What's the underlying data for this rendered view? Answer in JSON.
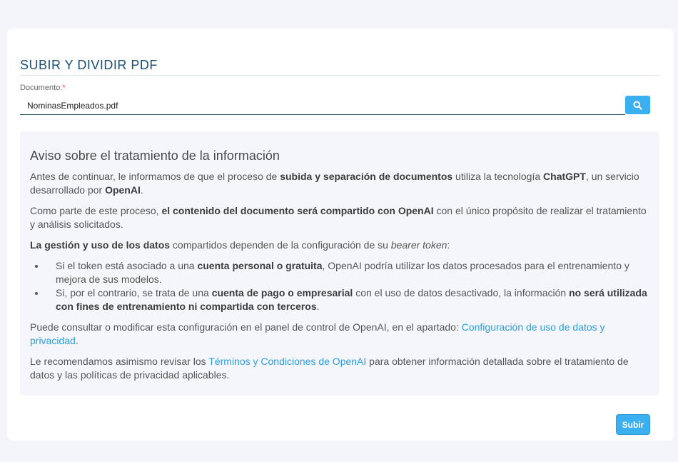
{
  "page": {
    "title": "SUBIR Y DIVIDIR PDF"
  },
  "document_field": {
    "label": "Documento:",
    "required_mark": "*",
    "value": "NominasEmpleados.pdf"
  },
  "search_button": {
    "icon": "search-icon"
  },
  "notice": {
    "heading": "Aviso sobre el tratamiento de la información",
    "p1": {
      "t1": "Antes de continuar, le informamos de que el proceso de ",
      "b1": "subida y separación de documentos",
      "t2": " utiliza la tecnología ",
      "b2": "ChatGPT",
      "t3": ", un servicio desarrollado por ",
      "b3": "OpenAI",
      "t4": "."
    },
    "p2": {
      "t1": "Como parte de este proceso, ",
      "b1": "el contenido del documento será compartido con OpenAI",
      "t2": " con el único propósito de realizar el tratamiento y análisis solicitados."
    },
    "p3": {
      "b1": "La gestión y uso de los datos",
      "t1": " compartidos dependen de la configuración de su ",
      "i1": "bearer token",
      "t2": ":"
    },
    "li1": {
      "t1": "Si el token está asociado a una ",
      "b1": "cuenta personal o gratuita",
      "t2": ", OpenAI podría utilizar los datos procesados para el entrenamiento y mejora de sus modelos."
    },
    "li2": {
      "t1": "Si, por el contrario, se trata de una ",
      "b1": "cuenta de pago o empresarial",
      "t2": " con el uso de datos desactivado, la información ",
      "b2": "no será utilizada con fines de entrenamiento ni compartida con terceros",
      "t3": "."
    },
    "p4": {
      "t1": "Puede consultar o modificar esta configuración en el panel de control de OpenAI, en el apartado: ",
      "link": "Configuración de uso de datos y privacidad",
      "t2": "."
    },
    "p5": {
      "t1": "Le recomendamos asimismo revisar los ",
      "link": "Términos y Condiciones de OpenAI",
      "t2": " para obtener información detallada sobre el tratamiento de datos y las políticas de privacidad aplicables."
    }
  },
  "submit_button": {
    "label": "Subir"
  },
  "colors": {
    "accent": "#3ab0f0",
    "title": "#1d4f73",
    "link": "#2a9ee0"
  }
}
